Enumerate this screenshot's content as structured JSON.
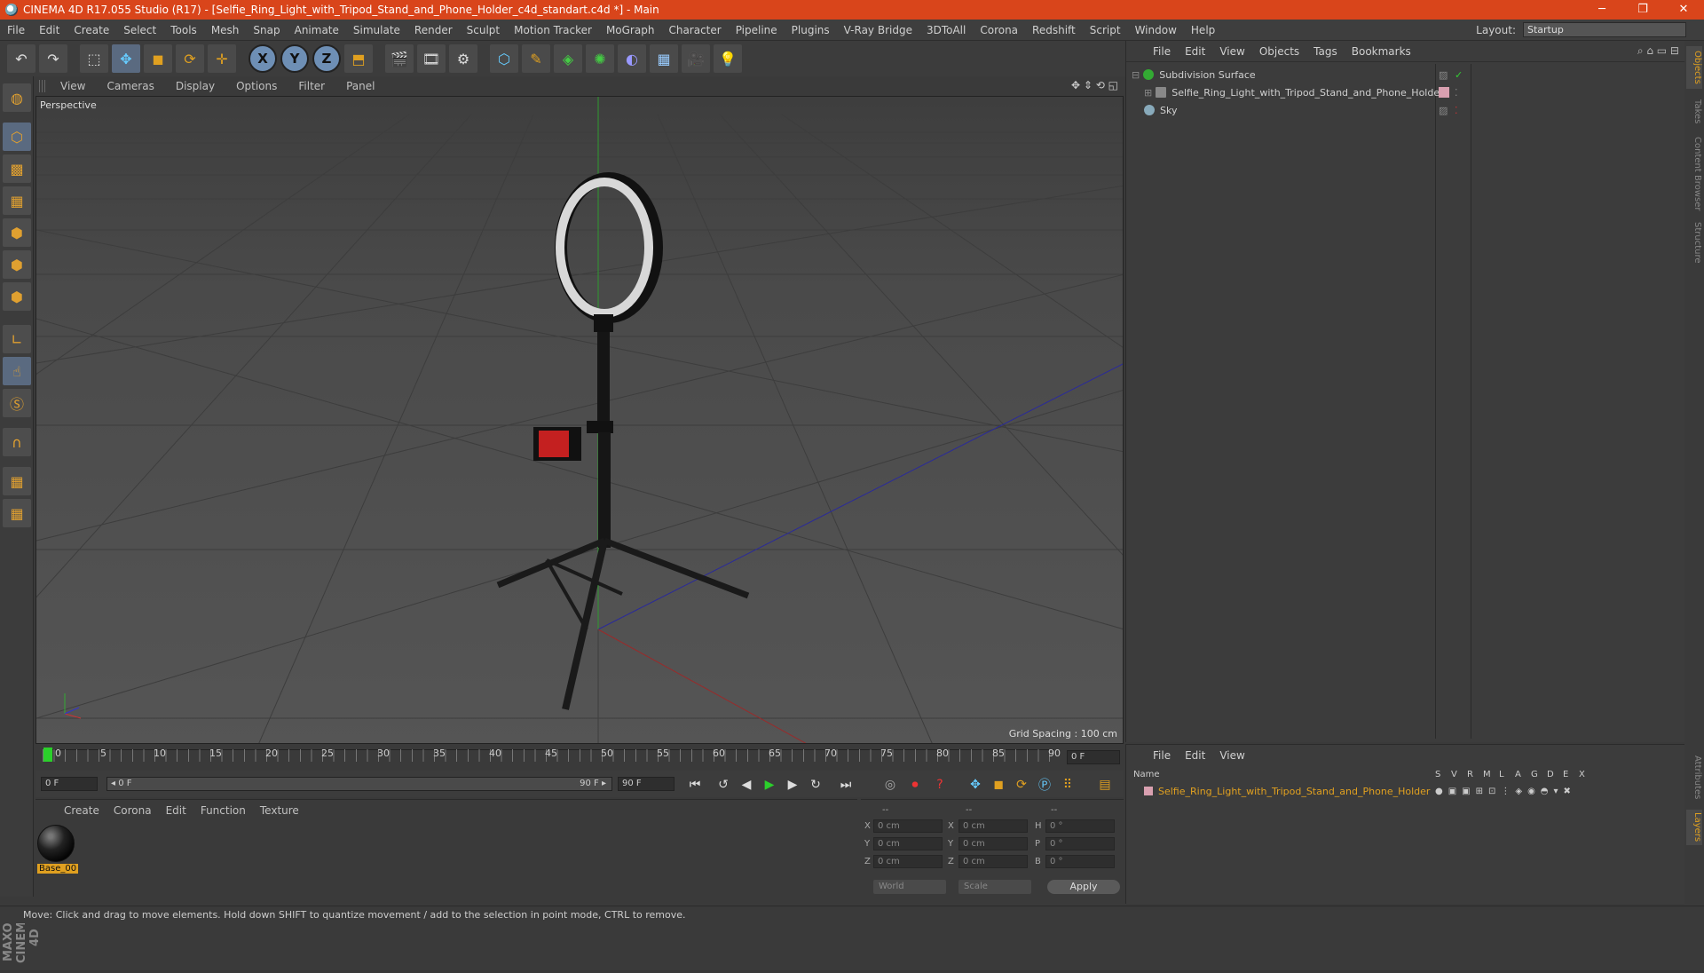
{
  "window": {
    "title": "CINEMA 4D R17.055 Studio (R17) - [Selfie_Ring_Light_with_Tripod_Stand_and_Phone_Holder_c4d_standart.c4d *] - Main",
    "minimize": "─",
    "restore": "❐",
    "close": "✕"
  },
  "menubar": {
    "items": [
      "File",
      "Edit",
      "Create",
      "Select",
      "Tools",
      "Mesh",
      "Snap",
      "Animate",
      "Simulate",
      "Render",
      "Sculpt",
      "Motion Tracker",
      "MoGraph",
      "Character",
      "Pipeline",
      "Plugins",
      "V-Ray Bridge",
      "3DToAll",
      "Corona",
      "Redshift",
      "Script",
      "Window",
      "Help"
    ],
    "layout_label": "Layout:",
    "layout_value": "Startup"
  },
  "toolbar": {
    "undo": "↶",
    "redo": "↷",
    "select": "⬚",
    "move": "✥",
    "scale": "◼",
    "rotate": "⟳",
    "transform": "✛",
    "axis_x": "X",
    "axis_y": "Y",
    "axis_z": "Z",
    "coord": "⬒",
    "render_view": "🎬",
    "render_pv": "🎞",
    "render_settings": "⚙",
    "cube": "⬡",
    "pen": "✎",
    "subdiv": "◈",
    "array": "✺",
    "deformer": "◐",
    "floor": "▦",
    "camera": "🎥",
    "light": "💡"
  },
  "viewport": {
    "menu": [
      "View",
      "Cameras",
      "Display",
      "Options",
      "Filter",
      "Panel"
    ],
    "label": "Perspective",
    "grid_spacing": "Grid Spacing : 100 cm",
    "nav_icons": "✥ ⇕ ⟲ ◱"
  },
  "timeline": {
    "ticks": [
      "0",
      "5",
      "10",
      "15",
      "20",
      "25",
      "30",
      "35",
      "40",
      "45",
      "50",
      "55",
      "60",
      "65",
      "70",
      "75",
      "80",
      "85",
      "90"
    ],
    "current_frame": "0 F",
    "start": "0 F",
    "range_start": "◂ 0 F",
    "range_end": "90 F ▸",
    "end": "90 F"
  },
  "material_panel": {
    "menu": [
      "Create",
      "Corona",
      "Edit",
      "Function",
      "Texture"
    ],
    "material_name": "Base_00"
  },
  "coord_panel": {
    "header": [
      "--",
      "--",
      "--"
    ],
    "rows": [
      {
        "l1": "X",
        "v1": "0 cm",
        "l2": "X",
        "v2": "0 cm",
        "l3": "H",
        "v3": "0 °"
      },
      {
        "l1": "Y",
        "v1": "0 cm",
        "l2": "Y",
        "v2": "0 cm",
        "l3": "P",
        "v3": "0 °"
      },
      {
        "l1": "Z",
        "v1": "0 cm",
        "l2": "Z",
        "v2": "0 cm",
        "l3": "B",
        "v3": "0 °"
      }
    ],
    "world": "World",
    "scale": "Scale",
    "apply": "Apply"
  },
  "object_panel": {
    "menu": [
      "File",
      "Edit",
      "View",
      "Objects",
      "Tags",
      "Bookmarks"
    ],
    "objects": [
      {
        "name": "Subdivision Surface"
      },
      {
        "name": "Selfie_Ring_Light_with_Tripod_Stand_and_Phone_Holder"
      },
      {
        "name": "Sky"
      }
    ]
  },
  "layer_panel": {
    "menu": [
      "File",
      "Edit",
      "View"
    ],
    "columns": [
      "Name",
      "S",
      "V",
      "R",
      "M",
      "L",
      "A",
      "G",
      "D",
      "E",
      "X"
    ],
    "layer_name": "Selfie_Ring_Light_with_Tripod_Stand_and_Phone_Holder"
  },
  "right_tabs": [
    "Objects",
    "Takes",
    "Content Browser",
    "Structure",
    "Attributes",
    "Layers"
  ],
  "brand": {
    "line1": "MAXON",
    "line2": "CINEMA 4D"
  },
  "status": "Move: Click and drag to move elements. Hold down SHIFT to quantize movement / add to the selection in point mode, CTRL to remove.",
  "colors": {
    "title_bar": "#d9451b",
    "accent": "#e0a020",
    "panel": "#3c3c3c"
  }
}
